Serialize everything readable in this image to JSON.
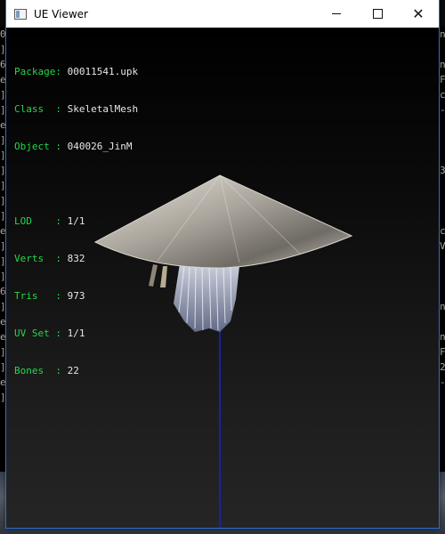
{
  "window": {
    "title": "UE Viewer"
  },
  "info": {
    "package": {
      "key": "Package:",
      "value": "00011541.upk"
    },
    "class": {
      "key": "Class  :",
      "value": "SkeletalMesh"
    },
    "object": {
      "key": "Object :",
      "value": "040026_JinM"
    },
    "lod": {
      "key": "LOD    :",
      "value": "1/1"
    },
    "verts": {
      "key": "Verts  :",
      "value": "832"
    },
    "tris": {
      "key": "Tris   :",
      "value": "973"
    },
    "uvset": {
      "key": "UV Set :",
      "value": "1/1"
    },
    "bones": {
      "key": "Bones  :",
      "value": "22"
    }
  },
  "background_console": {
    "left": [
      "0",
      "]",
      "6",
      "e",
      "]",
      "]",
      "e",
      "]",
      "]",
      "]",
      "]",
      "]",
      "]",
      "e",
      "]",
      "]",
      "]",
      "6",
      "]",
      "e",
      "e",
      "]",
      "]",
      "e",
      "]"
    ],
    "right": [
      "n",
      "",
      "n",
      "F",
      "c",
      "-",
      "",
      "",
      "",
      "3",
      "",
      "",
      "",
      "c",
      "V",
      "",
      "",
      "",
      "n",
      "",
      "n",
      "F",
      "2",
      "-",
      ""
    ]
  },
  "colors": {
    "info_key": "#22d84a",
    "info_value": "#e6e6e6",
    "axis_line": "#1a22a0",
    "window_border": "#2a6fd1"
  },
  "icons": {
    "app": "app-window-icon",
    "minimize": "minimize-icon",
    "maximize": "maximize-icon",
    "close": "close-icon"
  }
}
